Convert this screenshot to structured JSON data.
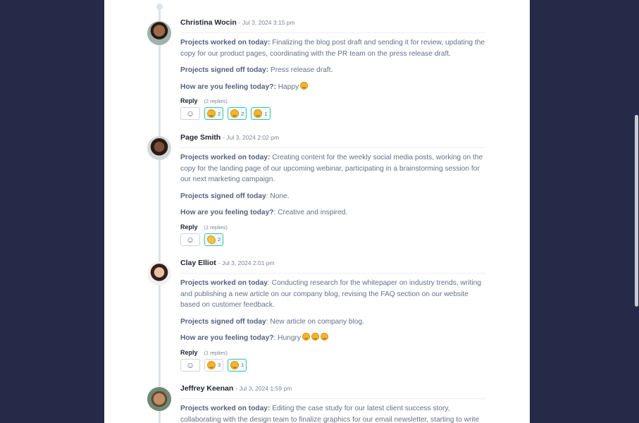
{
  "posts": [
    {
      "name": "Christina Wocin",
      "time": "- Jul 3, 2024 3:15 pm",
      "worked_label": "Projects worked on today:",
      "worked_text": " Finalizing the blog post draft and sending it for review, updating the copy for our product pages, coordinating with the PR team on the press release draft.",
      "signed_label": "Projects signed off today:",
      "signed_text": " Press release draft.",
      "feeling_label": "How are you feeling today?:",
      "feeling_text": " Happy",
      "feeling_emojis": [
        "smiling-face"
      ],
      "reply_label": "Reply",
      "replies": "(2 replies)",
      "reactions": [
        {
          "icon": "smiling-face-emoji",
          "count": "2",
          "active": true
        },
        {
          "icon": "star-struck-emoji",
          "count": "2",
          "active": true
        },
        {
          "icon": "relieved-face-emoji",
          "count": "1",
          "active": true
        }
      ]
    },
    {
      "name": "Page Smith",
      "time": "- Jul 3, 2024 2:02 pm",
      "worked_label": "Projects worked on today:",
      "worked_text": " Creating content for the weekly social media posts, working on the copy for the landing page of our upcoming webinar, participating in a brainstorming session for our next marketing campaign.",
      "signed_label": "Projects signed off today",
      "signed_text": ": None.",
      "feeling_label": "How are you feeling today?",
      "feeling_text": ": Creative and inspired.",
      "feeling_emojis": [],
      "reply_label": "Reply",
      "replies": "(1 replies)",
      "reactions": [
        {
          "icon": "clapping-hands-emoji",
          "count": "2",
          "active": true
        }
      ]
    },
    {
      "name": "Clay Elliot",
      "time": "- Jul 3, 2024 2:01 pm",
      "worked_label": "Projects worked on today",
      "worked_text": ": Conducting research for the whitepaper on industry trends, writing and publishing a new article on our company blog, revising the FAQ section on our website based on customer feedback.",
      "signed_label": "Projects signed off today",
      "signed_text": ": New article on company blog.",
      "feeling_label": "How are you feeling today?",
      "feeling_text": ": Hungry",
      "feeling_emojis": [
        "yum-face",
        "yum-face",
        "yum-face"
      ],
      "reply_label": "Reply",
      "replies": "(1 replies)",
      "reactions": [
        {
          "icon": "yum-face-emoji",
          "count": "3",
          "active": false
        },
        {
          "icon": "laughing-face-emoji",
          "count": "1",
          "active": true
        }
      ]
    },
    {
      "name": "Jeffrey Keenan",
      "time": "- Jul 3, 2024 1:59 pm",
      "worked_label": "Projects worked on today:",
      "worked_text": " Editing the case study for our latest client success story, collaborating with the design team to finalize graphics for our email newsletter, starting to write"
    }
  ]
}
